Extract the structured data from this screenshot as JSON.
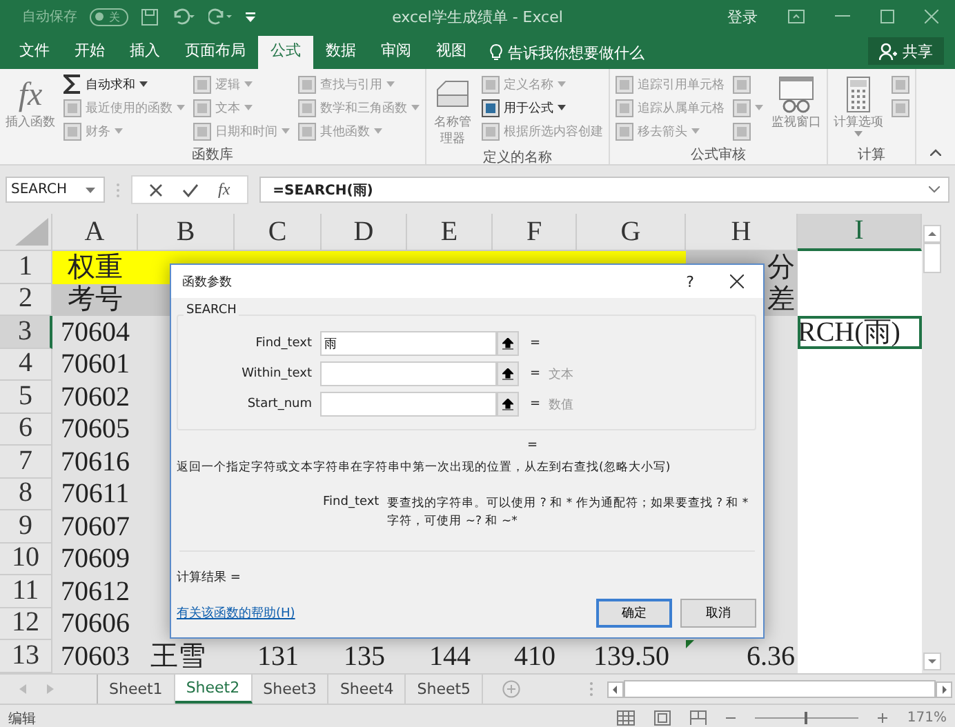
{
  "title_bar": {
    "autosave_label": "自动保存",
    "autosave_toggle": "关",
    "autosave_on": false,
    "title": "excel学生成绩单 - Excel",
    "sign_in": "登录"
  },
  "tabs": [
    {
      "label": "文件",
      "selected": false
    },
    {
      "label": "开始",
      "selected": false
    },
    {
      "label": "插入",
      "selected": false
    },
    {
      "label": "页面布局",
      "selected": false
    },
    {
      "label": "公式",
      "selected": true
    },
    {
      "label": "数据",
      "selected": false
    },
    {
      "label": "审阅",
      "selected": false
    },
    {
      "label": "视图",
      "selected": false
    }
  ],
  "tell_me": {
    "placeholder": "告诉我你想要做什么"
  },
  "share_button": "共享",
  "ribbon": {
    "groups": [
      {
        "label": "函数库",
        "items": [
          {
            "kind": "large",
            "symbol": "fx",
            "label": "插入函数",
            "disabled": true,
            "dropdown": false
          },
          {
            "kind": "column",
            "entries": [
              {
                "kind": "sum",
                "label": "自动求和",
                "dropdown": true,
                "disabled": false
              },
              {
                "kind": "menu",
                "label": "最近使用的函数",
                "dropdown": true,
                "disabled": true
              },
              {
                "kind": "menu",
                "label": "财务",
                "dropdown": true,
                "disabled": true
              }
            ]
          },
          {
            "kind": "column",
            "entries": [
              {
                "kind": "menu",
                "label": "逻辑",
                "dropdown": true,
                "disabled": true
              },
              {
                "kind": "menu",
                "label": "文本",
                "dropdown": true,
                "disabled": true
              },
              {
                "kind": "menu",
                "label": "日期和时间",
                "dropdown": true,
                "disabled": true
              }
            ]
          },
          {
            "kind": "column",
            "entries": [
              {
                "kind": "menu",
                "label": "查找与引用",
                "dropdown": true,
                "disabled": true
              },
              {
                "kind": "menu",
                "label": "数学和三角函数",
                "dropdown": true,
                "disabled": true
              },
              {
                "kind": "menu",
                "label": "其他函数",
                "dropdown": true,
                "disabled": true
              }
            ]
          }
        ]
      },
      {
        "label": "定义的名称",
        "items": [
          {
            "kind": "large",
            "label": "名称管理器",
            "disabled": true,
            "dropdown": false
          },
          {
            "kind": "column",
            "entries": [
              {
                "kind": "menu",
                "label": "定义名称",
                "dropdown": true,
                "disabled": true
              },
              {
                "kind": "menu",
                "label": "用于公式",
                "dropdown": true,
                "disabled": false
              },
              {
                "kind": "menu",
                "label": "根据所选内容创建",
                "dropdown": false,
                "disabled": true
              }
            ]
          }
        ]
      },
      {
        "label": "公式审核",
        "items": [
          {
            "kind": "column",
            "entries": [
              {
                "kind": "menu",
                "label": "追踪引用单元格",
                "dropdown": false,
                "disabled": true
              },
              {
                "kind": "menu",
                "label": "追踪从属单元格",
                "dropdown": false,
                "disabled": true
              },
              {
                "kind": "menu",
                "label": "移去箭头",
                "dropdown": true,
                "disabled": true
              }
            ]
          },
          {
            "kind": "column",
            "entries": [
              {
                "kind": "menu",
                "dropdown": false,
                "disabled": true
              },
              {
                "kind": "menu",
                "dropdown": true,
                "disabled": true
              },
              {
                "kind": "menu",
                "dropdown": false,
                "disabled": true
              }
            ]
          },
          {
            "kind": "large",
            "label": "监视窗口",
            "disabled": true,
            "dropdown": false
          }
        ]
      },
      {
        "label": "计算",
        "items": [
          {
            "kind": "large",
            "label": "计算选项",
            "disabled": true,
            "dropdown": true
          },
          {
            "kind": "column",
            "entries": [
              {
                "kind": "menu",
                "dropdown": false,
                "disabled": true
              },
              {
                "kind": "menu",
                "dropdown": false,
                "disabled": true
              }
            ]
          }
        ]
      }
    ]
  },
  "formula_bar": {
    "name_box": "SEARCH",
    "function_symbol": "fx",
    "formula": "=SEARCH(雨)"
  },
  "sheet": {
    "columns": [
      {
        "label": "A",
        "selected": false
      },
      {
        "label": "B",
        "selected": false
      },
      {
        "label": "C",
        "selected": false
      },
      {
        "label": "D",
        "selected": false
      },
      {
        "label": "E",
        "selected": false
      },
      {
        "label": "F",
        "selected": false
      },
      {
        "label": "G",
        "selected": false
      },
      {
        "label": "H",
        "selected": false
      },
      {
        "label": "I",
        "selected": true
      }
    ],
    "rows": [
      {
        "number": "1",
        "selected": false,
        "cells": [
          {
            "text": "权重",
            "color": "#ffff00"
          },
          {
            "color": "#ffff00"
          },
          {
            "color": "#ffff00"
          },
          {
            "color": "#ffff00"
          },
          {
            "color": "#ffff00"
          },
          {
            "color": "#ffff00"
          },
          {
            "color": "#ffff00"
          },
          {
            "text": "分",
            "color": "#c8c8c8"
          },
          {}
        ]
      },
      {
        "number": "2",
        "selected": false,
        "cells": [
          {
            "text": "考号",
            "color": "#c8c8c8"
          },
          {
            "color": "#c8c8c8"
          },
          {},
          {},
          {},
          {},
          {},
          {
            "text": "差",
            "color": "#c8c8c8"
          },
          {}
        ]
      },
      {
        "number": "3",
        "selected": true,
        "cells": [
          {
            "text": "70604"
          },
          {},
          {},
          {},
          {},
          {},
          {},
          {},
          {
            "text": "RCH(雨)",
            "selected": true
          }
        ]
      },
      {
        "number": "4",
        "selected": false,
        "cells": [
          {
            "text": "70601"
          },
          {},
          {},
          {},
          {},
          {},
          {},
          {},
          {}
        ]
      },
      {
        "number": "5",
        "selected": false,
        "cells": [
          {
            "text": "70602"
          },
          {},
          {},
          {},
          {},
          {},
          {},
          {},
          {}
        ]
      },
      {
        "number": "6",
        "selected": false,
        "cells": [
          {
            "text": "70605"
          },
          {},
          {},
          {},
          {},
          {},
          {},
          {},
          {}
        ]
      },
      {
        "number": "7",
        "selected": false,
        "cells": [
          {
            "text": "70616"
          },
          {},
          {},
          {},
          {},
          {},
          {},
          {},
          {}
        ]
      },
      {
        "number": "8",
        "selected": false,
        "cells": [
          {
            "text": "70611"
          },
          {},
          {},
          {},
          {},
          {},
          {},
          {},
          {}
        ]
      },
      {
        "number": "9",
        "selected": false,
        "cells": [
          {
            "text": "70607"
          },
          {},
          {},
          {},
          {},
          {},
          {},
          {},
          {}
        ]
      },
      {
        "number": "10",
        "selected": false,
        "cells": [
          {
            "text": "70609"
          },
          {},
          {},
          {},
          {},
          {},
          {},
          {},
          {}
        ]
      },
      {
        "number": "11",
        "selected": false,
        "cells": [
          {
            "text": "70612"
          },
          {},
          {},
          {},
          {},
          {},
          {},
          {},
          {}
        ]
      },
      {
        "number": "12",
        "selected": false,
        "cells": [
          {
            "text": "70606"
          },
          {},
          {},
          {},
          {},
          {},
          {},
          {},
          {}
        ]
      },
      {
        "number": "13",
        "selected": false,
        "cells": [
          {
            "text": "70603"
          },
          {
            "text": "王雪"
          },
          {
            "text": "131"
          },
          {
            "text": "135"
          },
          {
            "text": "144"
          },
          {
            "text": "410"
          },
          {
            "text": "139.50"
          },
          {
            "text": "6.36",
            "error_flag": true
          },
          {}
        ]
      }
    ]
  },
  "dialog": {
    "title": "函数参数",
    "help": "?",
    "function_name": "SEARCH",
    "arguments": [
      {
        "label": "Find_text",
        "value": "雨",
        "equals": "="
      },
      {
        "label": "Within_text",
        "equals": "=",
        "result": "文本"
      },
      {
        "label": "Start_num",
        "equals": "=",
        "result": "数值"
      }
    ],
    "formula_result": "=",
    "description": "返回一个指定字符或文本字符串在字符串中第一次出现的位置，从左到右查找(忽略大小写)",
    "arg_help_label": "Find_text",
    "arg_help": "要查找的字符串。可以使用 ? 和 * 作为通配符；如果要查找 ? 和 * 字符，可使用 ~? 和 ~*",
    "result_label": "计算结果 =",
    "help_link": "有关该函数的帮助(H)",
    "buttons": [
      {
        "label": "确定",
        "selected": true
      },
      {
        "label": "取消",
        "selected": false
      }
    ]
  },
  "sheet_tabs": [
    {
      "label": "Sheet1",
      "selected": false
    },
    {
      "label": "Sheet2",
      "selected": true
    },
    {
      "label": "Sheet3",
      "selected": false
    },
    {
      "label": "Sheet4",
      "selected": false
    },
    {
      "label": "Sheet5",
      "selected": false
    }
  ],
  "status_bar": {
    "mode": "编辑",
    "zoom": {
      "level": 0.48,
      "reading": "171%"
    }
  }
}
